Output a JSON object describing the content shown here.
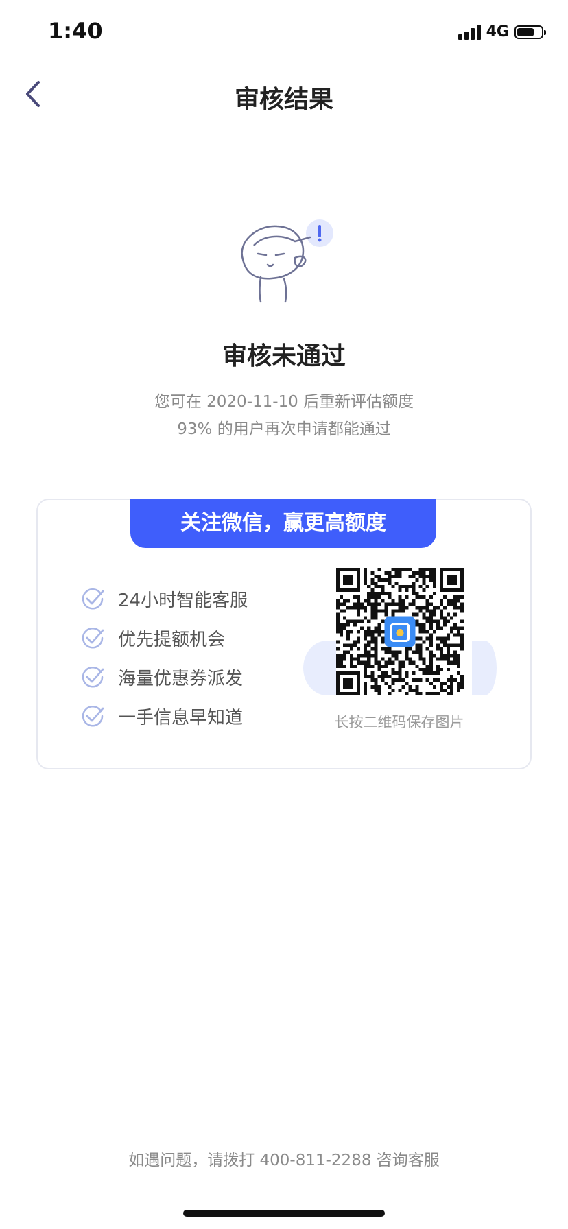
{
  "status_bar": {
    "time": "1:40",
    "network": "4G",
    "battery_level": 0.7
  },
  "nav": {
    "title": "审核结果",
    "back_icon": "chevron-left-icon"
  },
  "result": {
    "title": "审核未通过",
    "description_line1": "您可在 2020-11-10 后重新评估额度",
    "description_line2": "93% 的用户再次申请都能通过"
  },
  "card": {
    "banner": "关注微信，赢更高额度",
    "benefits": [
      {
        "label": "24小时智能客服"
      },
      {
        "label": "优先提额机会"
      },
      {
        "label": "海量优惠券派发"
      },
      {
        "label": "一手信息早知道"
      }
    ],
    "qr_caption": "长按二维码保存图片"
  },
  "footer": {
    "text": "如遇问题，请拨打 400-811-2288 咨询客服"
  },
  "colors": {
    "accent": "#3f5efb",
    "check": "#a9b6e6",
    "text_secondary": "#8a8a8a"
  }
}
